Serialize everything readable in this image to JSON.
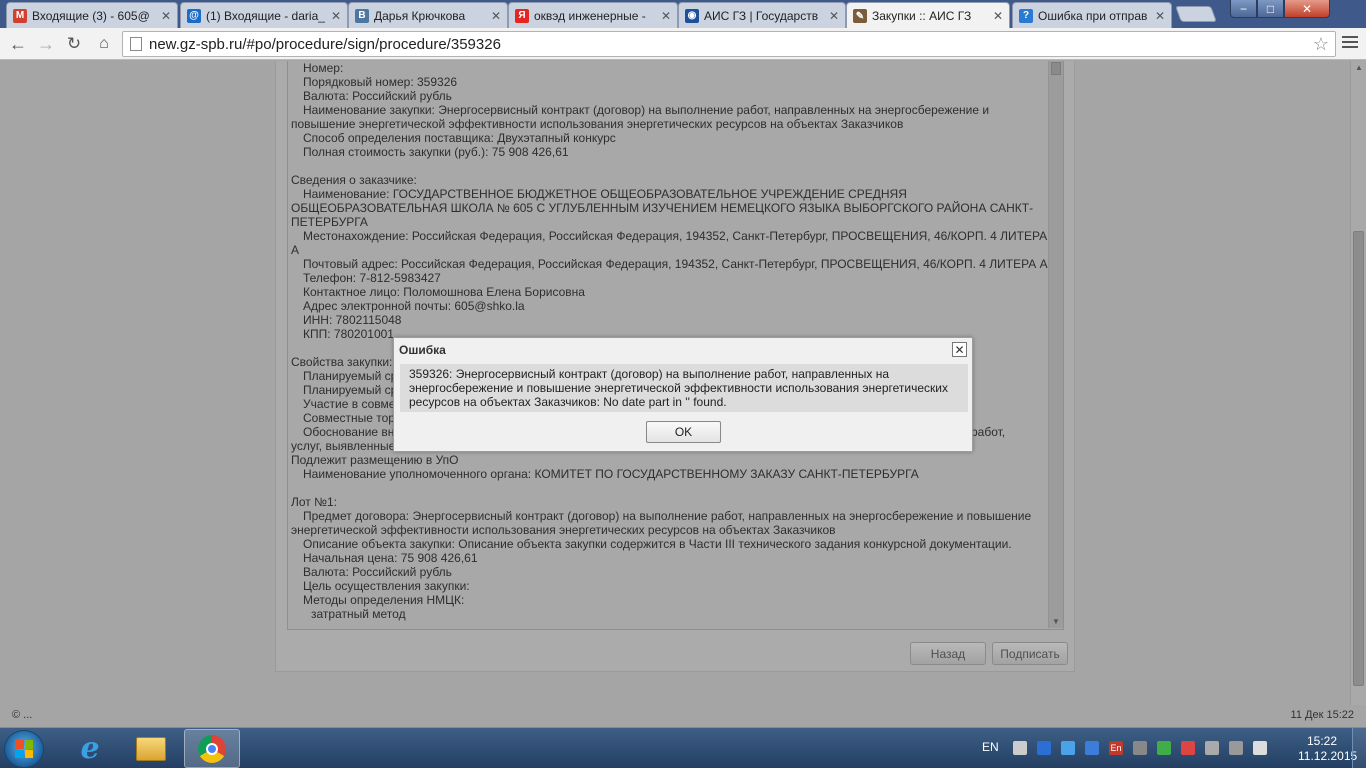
{
  "browser": {
    "tabs": [
      {
        "label": "Входящие (3) - 605@",
        "favicon": "gmail-icon",
        "color": "#d23f31",
        "glyph": "M"
      },
      {
        "label": "(1) Входящие - daria_",
        "favicon": "mail-ru-icon",
        "color": "#1a6cc8",
        "glyph": "@"
      },
      {
        "label": "Дарья Крючкова",
        "favicon": "vk-icon",
        "color": "#4d76a1",
        "glyph": "B"
      },
      {
        "label": "оквэд инженерные -",
        "favicon": "yandex-icon",
        "color": "#e52620",
        "glyph": "Я"
      },
      {
        "label": "АИС ГЗ | Государств",
        "favicon": "ais-gz-icon",
        "color": "#1f4f9c",
        "glyph": "◉"
      },
      {
        "label": "Закупки :: АИС ГЗ",
        "favicon": "tools-icon",
        "color": "#7a5c3d",
        "glyph": "✎"
      },
      {
        "label": "Ошибка при отправ",
        "favicon": "help-icon",
        "color": "#2a7ad1",
        "glyph": "?"
      }
    ],
    "active_tab": 5,
    "url": "new.gz-spb.ru/#po/procedure/sign/procedure/359326",
    "window_controls": {
      "minimize": "−",
      "maximize": "□",
      "close": "✕"
    }
  },
  "document": {
    "lines": [
      {
        "text": "Номер:",
        "indent": "i1"
      },
      {
        "text": "Порядковый номер: 359326",
        "indent": "i1"
      },
      {
        "text": "Валюта: Российский рубль",
        "indent": "i1"
      },
      {
        "text": "Наименование закупки: Энергосервисный контракт (договор) на выполнение работ, направленных на энергосбережение и повышение энергетической эффективности использования энергетических ресурсов на объектах Заказчиков",
        "indent": "i0w",
        "wrap": true
      },
      {
        "text": "Способ определения поставщика: Двухэтапный конкурс",
        "indent": "i1"
      },
      {
        "text": "Полная стоимость закупки (руб.): 75 908 426,61",
        "indent": "i1"
      },
      {
        "text": "",
        "indent": "sp"
      },
      {
        "text": "Сведения о заказчике:",
        "indent": ""
      },
      {
        "text": "Наименование: ГОСУДАРСТВЕННОЕ БЮДЖЕТНОЕ ОБЩЕОБРАЗОВАТЕЛЬНОЕ УЧРЕЖДЕНИЕ СРЕДНЯЯ ОБЩЕОБРАЗОВАТЕЛЬНАЯ ШКОЛА № 605 С УГЛУБЛЕННЫМ ИЗУЧЕНИЕМ НЕМЕЦКОГО ЯЗЫКА ВЫБОРГСКОГО РАЙОНА САНКТ-ПЕТЕРБУРГА",
        "indent": "i0w",
        "wrap": true
      },
      {
        "text": "Местонахождение: Российская Федерация, Российская Федерация, 194352, Санкт-Петербург, ПРОСВЕЩЕНИЯ, 46/КОРП. 4 ЛИТЕРА А",
        "indent": "i0w",
        "wrap": true
      },
      {
        "text": "Почтовый адрес: Российская Федерация, Российская Федерация, 194352, Санкт-Петербург, ПРОСВЕЩЕНИЯ, 46/КОРП. 4 ЛИТЕРА А",
        "indent": "i0w",
        "wrap": true
      },
      {
        "text": "Телефон: 7-812-5983427",
        "indent": "i1"
      },
      {
        "text": "Контактное лицо: Поломошнова Елена Борисовна",
        "indent": "i1"
      },
      {
        "text": "Адрес электронной почты: 605@shko.la",
        "indent": "i1"
      },
      {
        "text": "ИНН: 7802115048",
        "indent": "i1"
      },
      {
        "text": "КПП: 780201001",
        "indent": "i1"
      },
      {
        "text": "",
        "indent": "sp"
      },
      {
        "text": "Свойства закупки:",
        "indent": ""
      },
      {
        "text": "Планируемый ср",
        "indent": "i1"
      },
      {
        "text": "Планируемый ср",
        "indent": "i1"
      },
      {
        "text": "Участие в совме",
        "indent": "i1"
      },
      {
        "text": "Совместные тор",
        "indent": "i1"
      },
      {
        "text": "Обоснование вн",
        "indent": "i1",
        "tail": "работ,"
      },
      {
        "text": "услуг, выявленные",
        "indent": ""
      },
      {
        "text": "Подлежит размещению в УпО",
        "indent": ""
      },
      {
        "text": "Наименование уполномоченного органа: КОМИТЕТ ПО ГОСУДАРСТВЕННОМУ ЗАКАЗУ САНКТ-ПЕТЕРБУРГА",
        "indent": "i1"
      },
      {
        "text": "",
        "indent": "sp"
      },
      {
        "text": "Лот №1:",
        "indent": ""
      },
      {
        "text": "Предмет договора: Энергосервисный контракт (договор) на выполнение работ, направленных на энергосбережение и повышение энергетической эффективности использования энергетических ресурсов на объектах Заказчиков",
        "indent": "i0w",
        "wrap": true
      },
      {
        "text": "Описание объекта закупки: Описание объекта закупки содержится в Части III технического задания конкурсной документации.",
        "indent": "i1"
      },
      {
        "text": "Начальная цена: 75 908 426,61",
        "indent": "i1"
      },
      {
        "text": "Валюта: Российский рубль",
        "indent": "i1"
      },
      {
        "text": "Цель осуществления закупки:",
        "indent": "i1"
      },
      {
        "text": "Методы определения НМЦК:",
        "indent": "i1"
      },
      {
        "text": "затратный метод",
        "indent": "i2"
      }
    ]
  },
  "actions": {
    "back": "Назад",
    "sign": "Подписать"
  },
  "dialog": {
    "title": "Ошибка",
    "message": "359326: Энергосервисный контракт (договор) на выполнение работ, направленных на энергосбережение и повышение энергетической эффективности использования энергетических ресурсов на объектах Заказчиков: No date part in '' found.",
    "ok": "OK",
    "close_glyph": "✕"
  },
  "statusbar": {
    "left": "© ...",
    "right": "11 Дек 15:22"
  },
  "taskbar": {
    "language": "EN",
    "tray_icons": [
      "network-settings-icon",
      "bluetooth-icon",
      "cloud-icon",
      "wifi-icon",
      "lang-en-icon",
      "keyboard-icon",
      "security-check-icon",
      "flag-icon",
      "usb-icon",
      "monitor-icon",
      "volume-icon"
    ],
    "tray_en_label": "En",
    "time": "15:22",
    "date": "11.12.2015"
  }
}
